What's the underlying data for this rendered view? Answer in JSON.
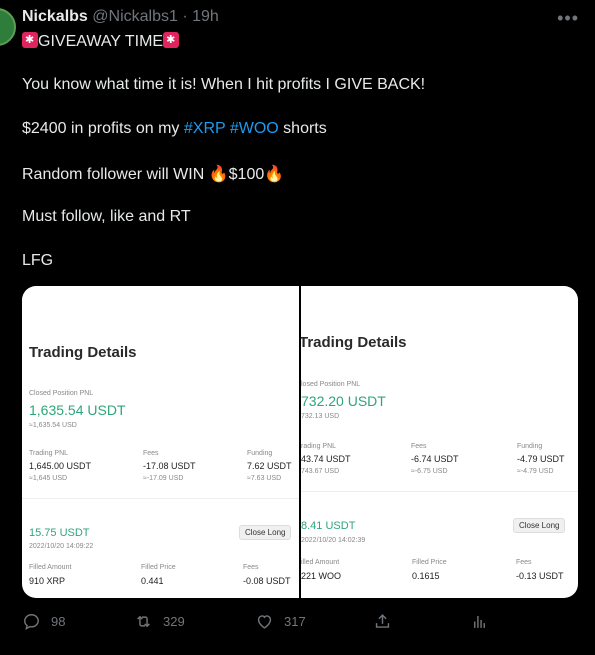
{
  "user": {
    "name": "Nickalbs",
    "handle": "@Nickalbs1",
    "dot": "·",
    "time": "19h"
  },
  "more_glyph": "•••",
  "tweet": {
    "line1_text": "GIVEAWAY TIME",
    "line2": "You know what time it is! When I hit profits I GIVE BACK!",
    "line3_a": "$2400 in profits on my ",
    "line3_tag1": "#XRP",
    "line3_tag2": "#WOO",
    "line3_b": " shorts",
    "line4_a": "Random follower will WIN ",
    "line4_b": "$100",
    "line5": "Must follow, like and RT",
    "line6": "LFG"
  },
  "cards": {
    "left": {
      "title": "Trading Details",
      "closed_label": "Closed Position PNL",
      "closed_value": "1,635.54 USDT",
      "closed_sub": "≈1,635.54 USD",
      "trading_pnl_label": "Trading PNL",
      "trading_pnl_value": "1,645.00 USDT",
      "trading_pnl_sub": "≈1,645 USD",
      "fees_label": "Fees",
      "fees_value": "-17.08 USDT",
      "fees_sub": "≈-17.09 USD",
      "funding_label": "Funding",
      "funding_value": "7.62 USDT",
      "funding_sub": "≈7.63 USD",
      "pos_value": "15.75 USDT",
      "pos_time": "2022/10/20 14:09:22",
      "close_btn": "Close Long",
      "filled_amount_label": "Filled Amount",
      "filled_amount_value": "910 XRP",
      "filled_price_label": "Filled Price",
      "filled_price_value": "0.441",
      "fees2_label": "Fees",
      "fees2_value": "-0.08 USDT"
    },
    "right": {
      "title": "Trading Details",
      "closed_label": "losed Position PNL",
      "closed_value": "732.20 USDT",
      "closed_sub": "732.13 USD",
      "trading_pnl_label": "rading PNL",
      "trading_pnl_value": "43.74 USDT",
      "trading_pnl_sub": "743.67 USD",
      "fees_label": "Fees",
      "fees_value": "-6.74 USDT",
      "fees_sub": "≈-6.75 USD",
      "funding_label": "Funding",
      "funding_value": "-4.79 USDT",
      "funding_sub": "≈-4.79 USD",
      "pos_value": "8.41 USDT",
      "pos_time": "2022/10/20 14:02:39",
      "close_btn": "Close Long",
      "filled_amount_label": "illed Amount",
      "filled_amount_value": "221 WOO",
      "filled_price_label": "Filled Price",
      "filled_price_value": "0.1615",
      "fees2_label": "Fees",
      "fees2_value": "-0.13 USDT"
    }
  },
  "actions": {
    "replies": "98",
    "retweets": "329",
    "likes": "317"
  },
  "colors": {
    "accent": "#1d9bf0",
    "profit_green": "#2ea67a",
    "muted": "#71767b"
  }
}
